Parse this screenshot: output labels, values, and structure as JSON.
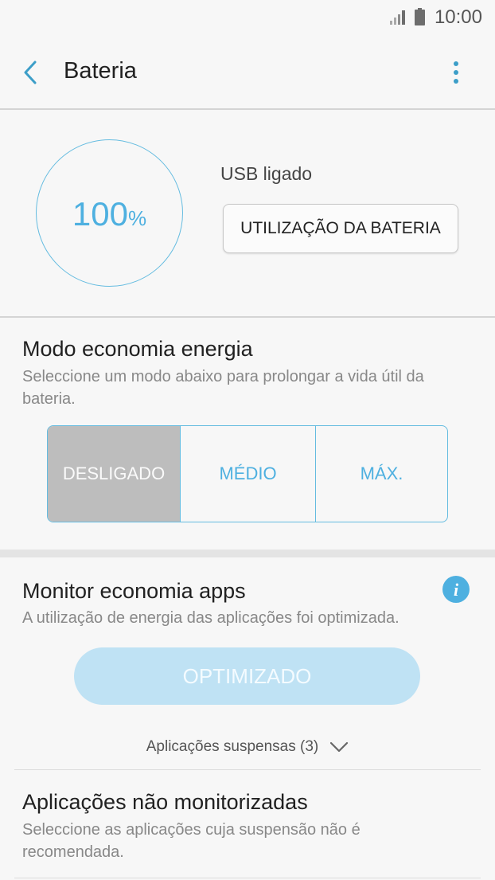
{
  "status_bar": {
    "time": "10:00",
    "icons": [
      "signal-icon",
      "battery-icon"
    ]
  },
  "header": {
    "title": "Bateria",
    "icons": [
      "back-icon",
      "more-vertical-icon"
    ]
  },
  "battery": {
    "level": 100,
    "level_text": "100",
    "unit": "%",
    "charging_status": "USB ligado",
    "usage_button": "UTILIZAÇÃO DA BATERIA"
  },
  "power_saving": {
    "title": "Modo economia energia",
    "description": "Seleccione um modo abaixo para prolongar a vida útil da bateria.",
    "modes": [
      "DESLIGADO",
      "MÉDIO",
      "MÁX."
    ],
    "selected": "DESLIGADO"
  },
  "app_monitor": {
    "title": "Monitor economia apps",
    "description": "A utilização de energia das aplicações foi optimizada.",
    "button": "OPTIMIZADO",
    "suspended_label": "Aplicações suspensas (3)",
    "info_icon": "info-icon"
  },
  "unmonitored": {
    "title": "Aplicações não monitorizadas",
    "description": "Seleccione as aplicações cuja suspensão não é recomendada."
  },
  "colors": {
    "accent": "#4eb0e0",
    "selected_mode_bg": "#bdbdbd",
    "optimized_button_bg": "#bfe2f4",
    "background": "#f7f7f7"
  }
}
